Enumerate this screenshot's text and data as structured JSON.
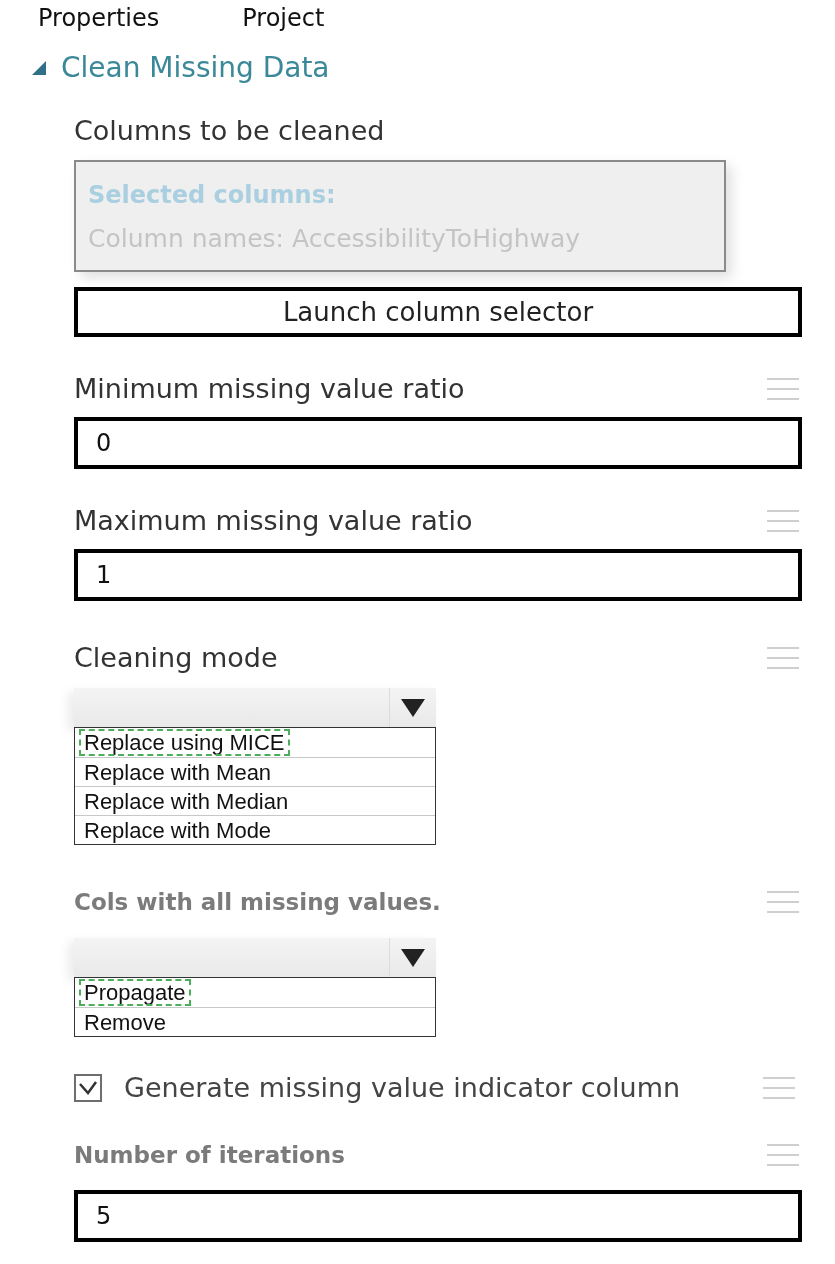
{
  "tabs": [
    {
      "label": "Properties"
    },
    {
      "label": "Project"
    }
  ],
  "module": {
    "title": "Clean Missing Data",
    "expanded": true,
    "fields": [
      {
        "kind": "columns",
        "label": "Columns to be cleaned",
        "bold": false,
        "help": false,
        "heading": "Selected columns:",
        "detail": "Column names: AccessibilityToHighway",
        "button": "Launch column selector"
      },
      {
        "kind": "number",
        "label": "Minimum missing value ratio",
        "bold": false,
        "help": true,
        "value": "0"
      },
      {
        "kind": "number",
        "label": "Maximum missing value ratio",
        "bold": false,
        "help": true,
        "value": "1"
      },
      {
        "kind": "dropdown",
        "label": "Cleaning mode",
        "bold": false,
        "help": true,
        "options": [
          {
            "label": "Replace using MICE",
            "selected": true
          },
          {
            "label": "Replace with Mean",
            "selected": false
          },
          {
            "label": "Replace with Median",
            "selected": false
          },
          {
            "label": "Replace with Mode",
            "selected": false
          }
        ]
      },
      {
        "kind": "dropdown",
        "label": "Cols with all missing values.",
        "bold": true,
        "help": true,
        "options": [
          {
            "label": "Propagate",
            "selected": true
          },
          {
            "label": "Remove",
            "selected": false
          }
        ]
      },
      {
        "kind": "checkbox",
        "label": "Generate missing value indicator column",
        "bold": false,
        "help": true,
        "checked": true
      },
      {
        "kind": "number",
        "label": "Number of iterations",
        "bold": true,
        "help": true,
        "value": "5"
      }
    ]
  }
}
